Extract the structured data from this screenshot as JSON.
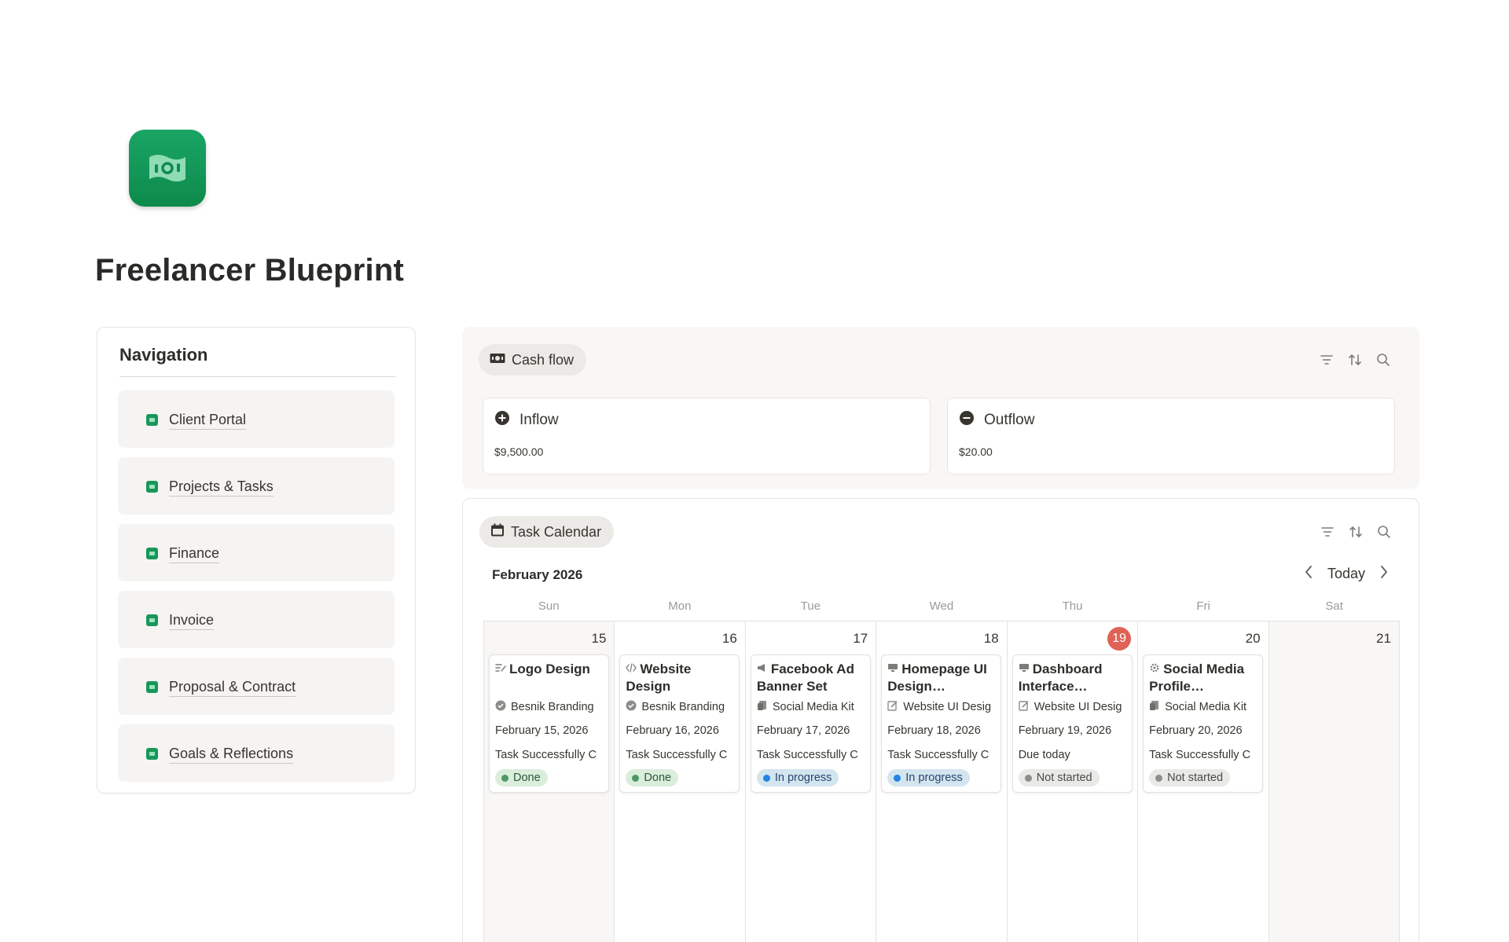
{
  "page": {
    "title": "Freelancer Blueprint",
    "icon": "money-icon"
  },
  "navigation": {
    "heading": "Navigation",
    "items": [
      {
        "label": "Client Portal",
        "icon": "page-icon"
      },
      {
        "label": "Projects & Tasks",
        "icon": "page-icon"
      },
      {
        "label": "Finance",
        "icon": "page-icon"
      },
      {
        "label": "Invoice",
        "icon": "page-icon"
      },
      {
        "label": "Proposal & Contract",
        "icon": "page-icon"
      },
      {
        "label": "Goals & Reflections",
        "icon": "page-icon"
      }
    ]
  },
  "cash_flow": {
    "label": "Cash flow",
    "inflow": {
      "label": "Inflow",
      "value": "$9,500.00"
    },
    "outflow": {
      "label": "Outflow",
      "value": "$20.00"
    }
  },
  "calendar": {
    "label": "Task Calendar",
    "month": "February 2026",
    "today_label": "Today",
    "weekdays": [
      "Sun",
      "Mon",
      "Tue",
      "Wed",
      "Thu",
      "Fri",
      "Sat"
    ],
    "days": [
      "15",
      "16",
      "17",
      "18",
      "19",
      "20",
      "21"
    ],
    "tasks": [
      {
        "title": "Logo Design",
        "relation": "Besnik Branding",
        "date": "February 15, 2026",
        "note": "Task Successfully C",
        "status": "Done"
      },
      {
        "title": "Website Design",
        "relation": "Besnik Branding",
        "date": "February 16, 2026",
        "note": "Task Successfully C",
        "status": "Done"
      },
      {
        "title": "Facebook Ad Banner Set",
        "relation": "Social Media Kit",
        "date": "February 17, 2026",
        "note": "Task Successfully C",
        "status": "In progress"
      },
      {
        "title": "Homepage UI Design…",
        "relation": "Website UI Desig",
        "date": "February 18, 2026",
        "note": "Task Successfully C",
        "status": "In progress"
      },
      {
        "title": "Dashboard Interface…",
        "relation": "Website UI Desig",
        "date": "February 19, 2026",
        "note": "Due today",
        "status": "Not started"
      },
      {
        "title": "Social Media Profile…",
        "relation": "Social Media Kit",
        "date": "February 20, 2026",
        "note": "Task Successfully C",
        "status": "Not started"
      }
    ]
  },
  "colors": {
    "accent_green": "#17975a",
    "today_red": "#e06155"
  }
}
